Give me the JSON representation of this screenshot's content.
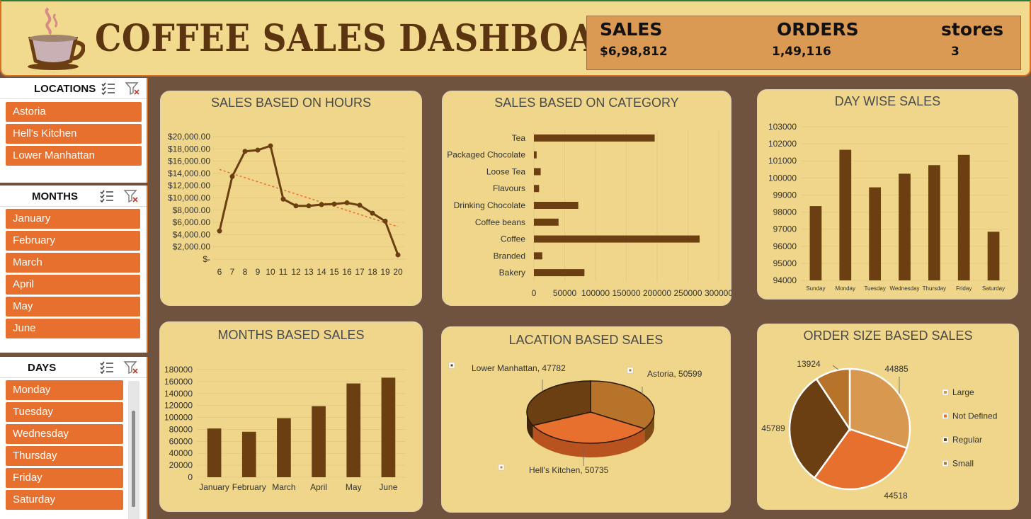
{
  "header": {
    "title": "COFFEE SALES DASHBOARD",
    "kpis": [
      {
        "label": "SALES",
        "value": "$6,98,812"
      },
      {
        "label": "ORDERS",
        "value": "1,49,116"
      },
      {
        "label": "stores",
        "value": "3"
      }
    ]
  },
  "slicers": {
    "locations": {
      "title": "LOCATIONS",
      "items": [
        "Astoria",
        "Hell's Kitchen",
        "Lower Manhattan"
      ]
    },
    "months": {
      "title": "MONTHS",
      "items": [
        "January",
        "February",
        "March",
        "April",
        "May",
        "June"
      ]
    },
    "days": {
      "title": "DAYS",
      "items": [
        "Monday",
        "Tuesday",
        "Wednesday",
        "Thursday",
        "Friday",
        "Saturday"
      ]
    }
  },
  "colors": {
    "accent": "#e8702f",
    "dark_brown": "#6b3f12",
    "panel": "#efd68a",
    "background": "#70533f"
  },
  "chart_data": [
    {
      "id": "hours",
      "type": "line",
      "title": "SALES BASED ON HOURS",
      "x": [
        "6",
        "7",
        "8",
        "9",
        "10",
        "11",
        "12",
        "13",
        "14",
        "15",
        "16",
        "17",
        "18",
        "19",
        "20"
      ],
      "values": [
        4600,
        13500,
        17600,
        17800,
        18500,
        9800,
        8700,
        8700,
        8900,
        9000,
        9200,
        8800,
        7500,
        6200,
        700
      ],
      "ytick_labels": [
        "$-",
        "$2,000.00",
        "$4,000.00",
        "$6,000.00",
        "$8,000.00",
        "$10,000.00",
        "$12,000.00",
        "$14,000.00",
        "$16,000.00",
        "$18,000.00",
        "$20,000.00"
      ],
      "ylim": [
        0,
        20000
      ],
      "trendline": true
    },
    {
      "id": "category",
      "type": "bar",
      "orientation": "horizontal",
      "title": "SALES BASED ON CATEGORY",
      "categories": [
        "Tea",
        "Packaged Chocolate",
        "Loose Tea",
        "Flavours",
        "Drinking Chocolate",
        "Coffee beans",
        "Coffee",
        "Branded",
        "Bakery"
      ],
      "values": [
        196000,
        4400,
        11000,
        8400,
        72000,
        40000,
        269000,
        13600,
        82000
      ],
      "xtick_labels": [
        "0",
        "50000",
        "100000",
        "150000",
        "200000",
        "250000",
        "300000"
      ],
      "xlim": [
        0,
        300000
      ]
    },
    {
      "id": "days",
      "type": "bar",
      "title": "DAY WISE SALES",
      "categories": [
        "Sunday",
        "Monday",
        "Tuesday",
        "Wednesday",
        "Thursday",
        "Friday",
        "Saturday"
      ],
      "values": [
        98350,
        101650,
        99450,
        100250,
        100750,
        101350,
        96850
      ],
      "ytick_labels": [
        "94000",
        "95000",
        "96000",
        "97000",
        "98000",
        "99000",
        "100000",
        "101000",
        "102000",
        "103000"
      ],
      "ylim": [
        94000,
        103000
      ]
    },
    {
      "id": "months",
      "type": "bar",
      "title": "MONTHS BASED SALES",
      "categories": [
        "January",
        "February",
        "March",
        "April",
        "May",
        "June"
      ],
      "values": [
        81500,
        76000,
        98800,
        118900,
        156800,
        166500
      ],
      "ytick_labels": [
        "0",
        "20000",
        "40000",
        "60000",
        "80000",
        "100000",
        "120000",
        "140000",
        "160000",
        "180000"
      ],
      "ylim": [
        0,
        180000
      ]
    },
    {
      "id": "locations",
      "type": "pie",
      "title": "LACATION BASED SALES",
      "labels": [
        "Astoria",
        "Hell's Kitchen",
        "Lower Manhattan"
      ],
      "values": [
        50599,
        50735,
        47782
      ],
      "data_labels": [
        "Astoria, 50599",
        "Hell's Kitchen, 50735",
        "Lower Manhattan, 47782"
      ],
      "colors": [
        "#b8732a",
        "#e8702f",
        "#6b3f12"
      ]
    },
    {
      "id": "ordersize",
      "type": "pie",
      "title": "ORDER SIZE BASED SALES",
      "labels": [
        "Large",
        "Not Defined",
        "Regular",
        "Small"
      ],
      "values": [
        44885,
        44518,
        45789,
        13924
      ],
      "data_labels": [
        "44885",
        "44518",
        "45789",
        "13924"
      ],
      "legend": "right",
      "colors": [
        "#d9984f",
        "#e8702f",
        "#6b3f12",
        "#b8732a"
      ]
    }
  ]
}
